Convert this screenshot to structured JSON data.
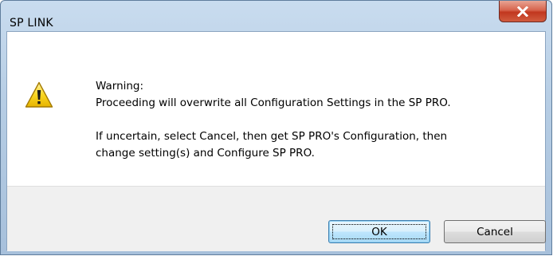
{
  "window": {
    "title": "SP LINK",
    "close_icon": "close-icon"
  },
  "dialog": {
    "icon": "warning-icon",
    "heading": "Warning:",
    "line1": "Proceeding will overwrite all Configuration Settings in the SP PRO.",
    "line2": "If uncertain, select Cancel, then get SP PRO's Configuration, then",
    "line3": "change setting(s) and Configure SP PRO."
  },
  "buttons": {
    "ok_label": "OK",
    "cancel_label": "Cancel"
  },
  "colors": {
    "titlebar": "#b6cde4",
    "close_button": "#c1371f",
    "warning_yellow": "#f7d11a",
    "footer": "#f0f0f0"
  }
}
